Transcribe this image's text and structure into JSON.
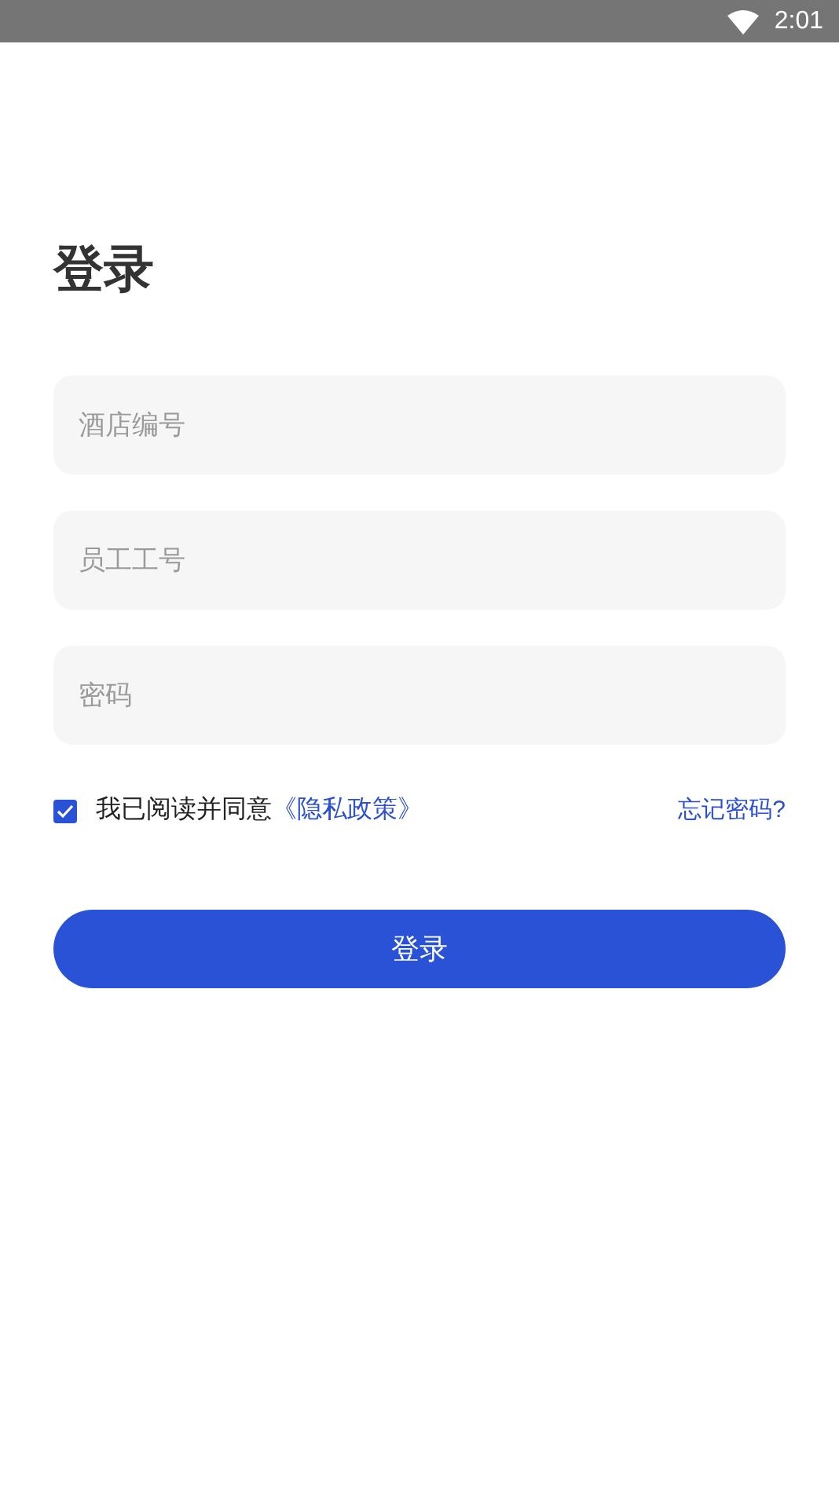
{
  "status_bar": {
    "time": "2:01"
  },
  "title": "登录",
  "fields": [
    {
      "placeholder": "酒店编号"
    },
    {
      "placeholder": "员工工号"
    },
    {
      "placeholder": "密码"
    }
  ],
  "agreement": {
    "checked": true,
    "text": "我已阅读并同意",
    "link": "《隐私政策》"
  },
  "forgot_link": "忘记密码?",
  "login_button": "登录"
}
